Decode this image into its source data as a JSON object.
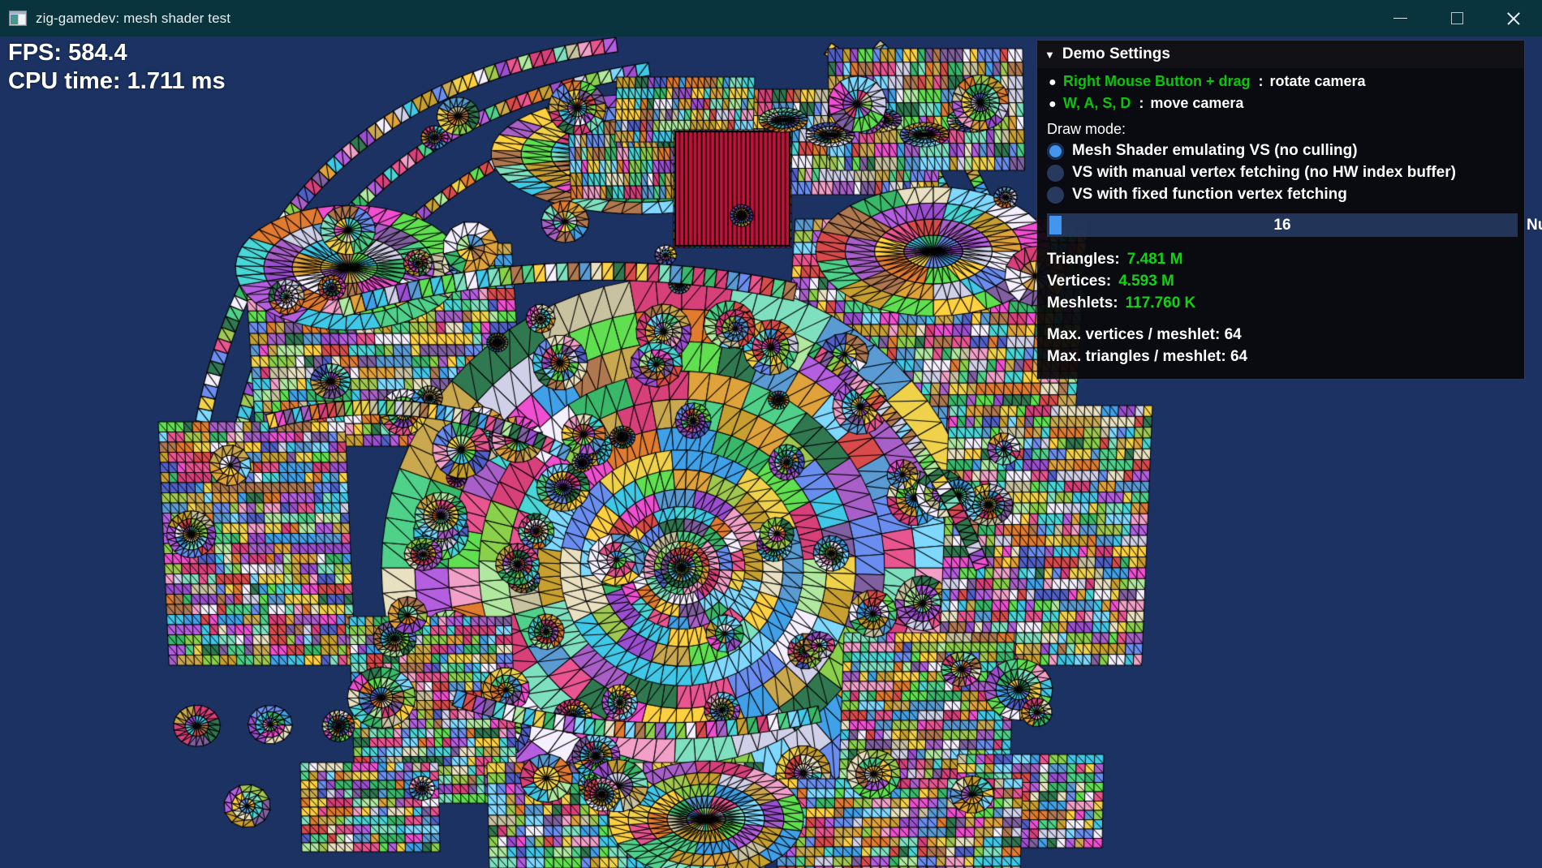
{
  "window": {
    "title": "zig-gamedev: mesh shader test",
    "icon": "app-window-icon",
    "controls": {
      "minimize": "—",
      "maximize": "□",
      "close": "✕"
    },
    "titlebar_color": "#09333d",
    "background_color": "#1b3263"
  },
  "overlay": {
    "fps_line": "FPS: 584.4",
    "cpu_line": "CPU time: 1.711 ms",
    "fps_label": "FPS:",
    "fps_value": "584.4",
    "cpu_label": "CPU time:",
    "cpu_value": "1.711 ms"
  },
  "panel": {
    "arrow": "▼",
    "title": "Demo Settings",
    "help": [
      {
        "dot": "●",
        "key": "Right Mouse Button + drag",
        "sep": ":",
        "value": "rotate camera"
      },
      {
        "dot": "●",
        "key": "W, A, S, D",
        "sep": ":",
        "value": "move camera"
      }
    ],
    "draw_mode_label": "Draw mode:",
    "draw_modes": [
      {
        "label": "Mesh Shader emulating VS (no culling)",
        "selected": true
      },
      {
        "label": "VS with manual vertex fetching (no HW index buffer)",
        "selected": false
      },
      {
        "label": "VS with fixed function vertex fetching",
        "selected": false
      }
    ],
    "slider": {
      "value": "16",
      "caption": "Num. objects",
      "fill_percent": 2
    },
    "stats": [
      {
        "label": "Triangles:",
        "value": "7.481 M"
      },
      {
        "label": "Vertices:",
        "value": "4.593 M"
      },
      {
        "label": "Meshlets:",
        "value": "117.760 K"
      }
    ],
    "limits": [
      "Max. vertices / meshlet: 64",
      "Max. triangles / meshlet: 64"
    ],
    "accent_selected": "#4296f0",
    "accent_green": "#12d312",
    "stat_green": "#12d312"
  }
}
